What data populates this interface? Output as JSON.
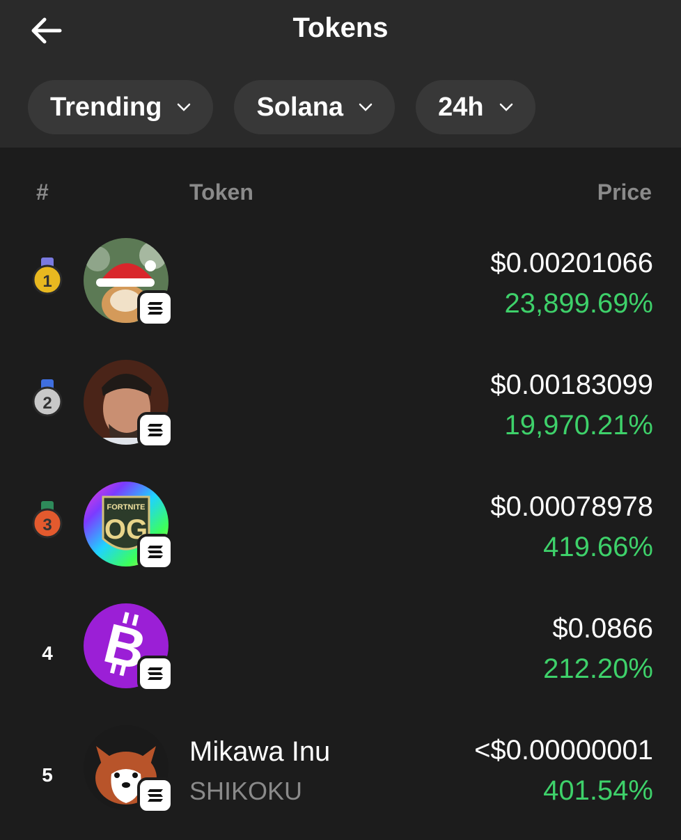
{
  "header": {
    "title": "Tokens"
  },
  "filters": [
    {
      "label": "Trending"
    },
    {
      "label": "Solana"
    },
    {
      "label": "24h"
    }
  ],
  "table": {
    "col_rank": "#",
    "col_token": "Token",
    "col_price": "Price"
  },
  "rows": [
    {
      "rank": "1",
      "name": "",
      "symbol": "",
      "price": "$0.00201066",
      "change": "23,899.69%",
      "medal_color": "#e8b820",
      "ribbon_color": "#7a7ae0"
    },
    {
      "rank": "2",
      "name": "",
      "symbol": "",
      "price": "$0.00183099",
      "change": "19,970.21%",
      "medal_color": "#c8c8c8",
      "ribbon_color": "#3f6fe0"
    },
    {
      "rank": "3",
      "name": "",
      "symbol": "",
      "price": "$0.00078978",
      "change": "419.66%",
      "medal_color": "#e35a2e",
      "ribbon_color": "#2e8a5a"
    },
    {
      "rank": "4",
      "name": "",
      "symbol": "",
      "price": "$0.0866",
      "change": "212.20%"
    },
    {
      "rank": "5",
      "name": "Mikawa Inu",
      "symbol": "SHIKOKU",
      "price": "<$0.00000001",
      "change": "401.54%"
    }
  ],
  "colors": {
    "positive": "#3ed16a",
    "muted": "#8a8a8a",
    "background": "#1c1c1c",
    "header_bg": "#2a2a2a"
  },
  "icons": {
    "back": "arrow-left-icon",
    "chain": "solana-icon",
    "dropdown": "chevron-down-icon"
  }
}
